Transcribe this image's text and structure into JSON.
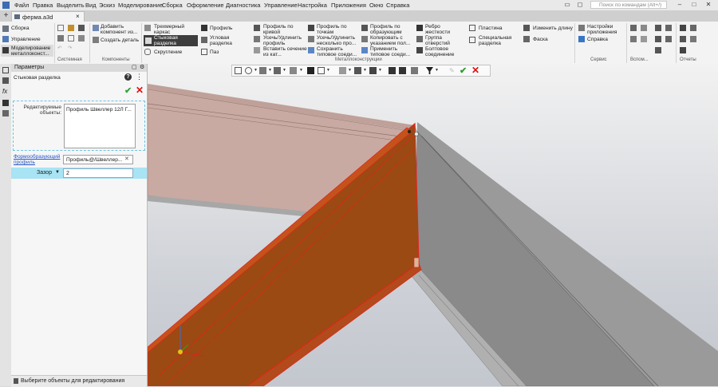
{
  "menubar": {
    "items": [
      "Файл",
      "Правка",
      "Выделить",
      "Вид",
      "Эскиз",
      "Моделирование",
      "Сборка",
      "Оформление",
      "Диагностика",
      "Управление",
      "Настройка",
      "Приложения",
      "Окно",
      "Справка"
    ],
    "search_placeholder": "Поиск по командам (Alt+/)"
  },
  "tabs": {
    "new_tab": "+",
    "document": "ферма.a3d",
    "close": "×"
  },
  "ribbon": {
    "modes": [
      "Сборка",
      "Управление",
      "Моделирование металлоконст..."
    ],
    "system": {
      "label": "Системная"
    },
    "components": {
      "add_component": "Добавить компонент из...",
      "create_part": "Создать деталь",
      "label": "Компоненты"
    },
    "metal": {
      "label": "Металлоконструкции",
      "frame": "Трехмерный каркас",
      "butt_cut": "Стыковая разделка",
      "rounding": "Скругление",
      "profile": "Профиль",
      "corner_cut": "Угловая разделка",
      "groove": "Паз",
      "profile_curve": "Профиль по кривой",
      "trim_extend": "Усечь/Удлинить профиль",
      "insert_section": "Вставить сечение из кат...",
      "profile_points": "Профиль по точкам",
      "trim_multi": "Усечь/Удлинить несколько про...",
      "save_joint": "Сохранить типовое соеди...",
      "profile_generators": "Профиль по образующим",
      "copy_indicated": "Копировать с указанием пол...",
      "apply_joint": "Применить типовое соеди...",
      "rib": "Ребро жесткости",
      "hole_group": "Группа отверстий",
      "bolt_joint": "Болтовое соединение",
      "plate": "Пластина",
      "special_cut": "Специальная разделка",
      "change_length": "Изменить длину",
      "chamfer": "Фаска"
    },
    "service": {
      "label": "Сервис",
      "app_settings": "Настройки приложения",
      "help": "Справка"
    },
    "aux_label": "Вспом...",
    "reports_label": "Отчеты"
  },
  "panel": {
    "title": "Параметры",
    "subtitle": "Стыковая разделка",
    "help": "?",
    "objects_label": "Редактируемые объекты:",
    "objects": [
      "Профиль Швеллер  12Л Г..."
    ],
    "profile_label": "Формообразующий профиль",
    "profile_value": "Профиль@/Швеллер...",
    "gap_label": "Зазор",
    "gap_value": "2",
    "status": "Выберите объекты для редактирования"
  },
  "colors": {
    "selected_beam": "#9d4a14",
    "selection_outline": "#e0261c",
    "beam_back": "#c9a9a2",
    "beam_grey": "#8d8d8d",
    "gap_row": "#a8e4f3"
  }
}
